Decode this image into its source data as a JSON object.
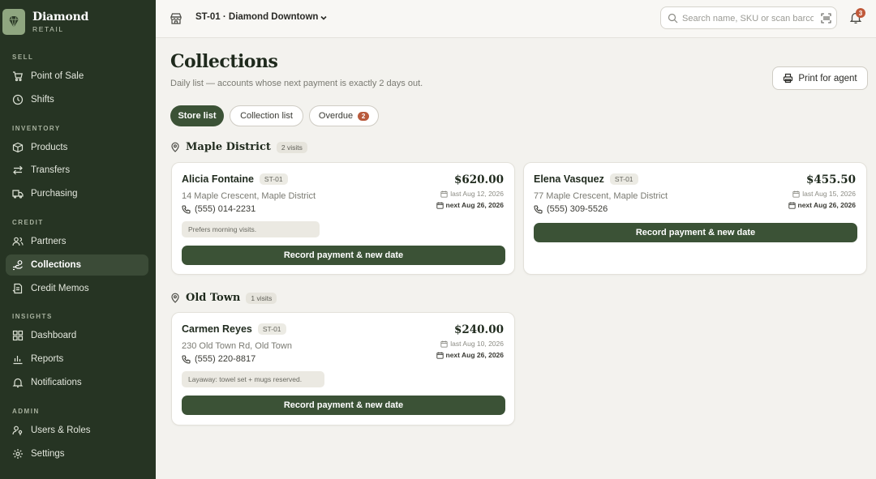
{
  "brand": {
    "name": "Diamond",
    "subtitle": "RETAIL"
  },
  "sidebar": {
    "sections": [
      {
        "label": "SELL"
      },
      {
        "label": "INVENTORY"
      },
      {
        "label": "CREDIT"
      },
      {
        "label": "INSIGHTS"
      },
      {
        "label": "ADMIN"
      }
    ],
    "items": [
      {
        "label": "Point of Sale",
        "icon": "cart-icon"
      },
      {
        "label": "Shifts",
        "icon": "clock-icon"
      },
      {
        "label": "Products",
        "icon": "box-icon"
      },
      {
        "label": "Transfers",
        "icon": "transfer-icon"
      },
      {
        "label": "Purchasing",
        "icon": "truck-icon"
      },
      {
        "label": "Partners",
        "icon": "users-icon"
      },
      {
        "label": "Collections",
        "icon": "hand-coins-icon",
        "active": true
      },
      {
        "label": "Credit Memos",
        "icon": "memo-icon"
      },
      {
        "label": "Dashboard",
        "icon": "grid-icon"
      },
      {
        "label": "Reports",
        "icon": "bar-chart-icon"
      },
      {
        "label": "Notifications",
        "icon": "bell-icon"
      },
      {
        "label": "Users & Roles",
        "icon": "user-key-icon"
      },
      {
        "label": "Settings",
        "icon": "gear-icon"
      }
    ]
  },
  "topbar": {
    "store": "ST-01 · Diamond Downtown",
    "search_placeholder": "Search name, SKU or scan barcode",
    "notification_count": "3"
  },
  "page": {
    "title": "Collections",
    "subtitle": "Daily list — accounts whose next payment is exactly 2 days out.",
    "print_label": "Print for agent"
  },
  "tabs": [
    {
      "label": "Store list",
      "active": true
    },
    {
      "label": "Collection list",
      "active": false
    },
    {
      "label": "Overdue",
      "active": false,
      "badge": "2"
    }
  ],
  "groups": [
    {
      "name": "Maple District",
      "visits": "2 visits",
      "cards": [
        {
          "name": "Alicia Fontaine",
          "store": "ST-01",
          "address": "14 Maple Crescent, Maple District",
          "phone": "(555) 014-2231",
          "note": "Prefers morning visits.",
          "amount": "$620.00",
          "last": "last Aug 12, 2026",
          "next": "next Aug 26, 2026",
          "button": "Record payment & new date"
        },
        {
          "name": "Elena Vasquez",
          "store": "ST-01",
          "address": "77 Maple Crescent, Maple District",
          "phone": "(555) 309-5526",
          "note": "",
          "amount": "$455.50",
          "last": "last Aug 15, 2026",
          "next": "next Aug 26, 2026",
          "button": "Record payment & new date"
        }
      ]
    },
    {
      "name": "Old Town",
      "visits": "1 visits",
      "cards": [
        {
          "name": "Carmen Reyes",
          "store": "ST-01",
          "address": "230 Old Town Rd, Old Town",
          "phone": "(555) 220-8817",
          "note": "Layaway: towel set + mugs reserved.",
          "amount": "$240.00",
          "last": "last Aug 10, 2026",
          "next": "next Aug 26, 2026",
          "button": "Record payment & new date"
        }
      ]
    }
  ],
  "colors": {
    "sidebar_bg": "#263423",
    "accent": "#3b5236",
    "badge": "#b85a3c"
  }
}
